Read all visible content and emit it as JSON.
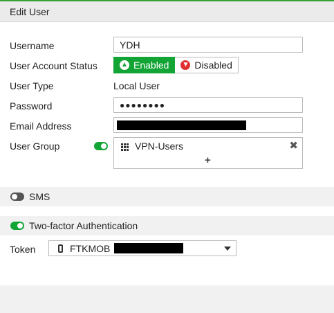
{
  "header": {
    "title": "Edit User"
  },
  "form": {
    "username": {
      "label": "Username",
      "value": "YDH"
    },
    "status": {
      "label": "User Account Status",
      "enabled_label": "Enabled",
      "disabled_label": "Disabled",
      "selected": "Enabled"
    },
    "user_type": {
      "label": "User Type",
      "value": "Local User"
    },
    "password": {
      "label": "Password",
      "value": "●●●●●●●●"
    },
    "email": {
      "label": "Email Address"
    },
    "user_group": {
      "label": "User Group",
      "enabled": true,
      "groups": [
        "VPN-Users"
      ]
    }
  },
  "sms": {
    "label": "SMS",
    "enabled": false
  },
  "two_factor": {
    "label": "Two-factor Authentication",
    "enabled": true,
    "token_label": "Token",
    "token_value": "FTKMOB"
  },
  "colors": {
    "accent": "#13a436",
    "danger": "#e03131",
    "header_bg": "#ebebeb",
    "section_bg": "#f1f1f1"
  }
}
